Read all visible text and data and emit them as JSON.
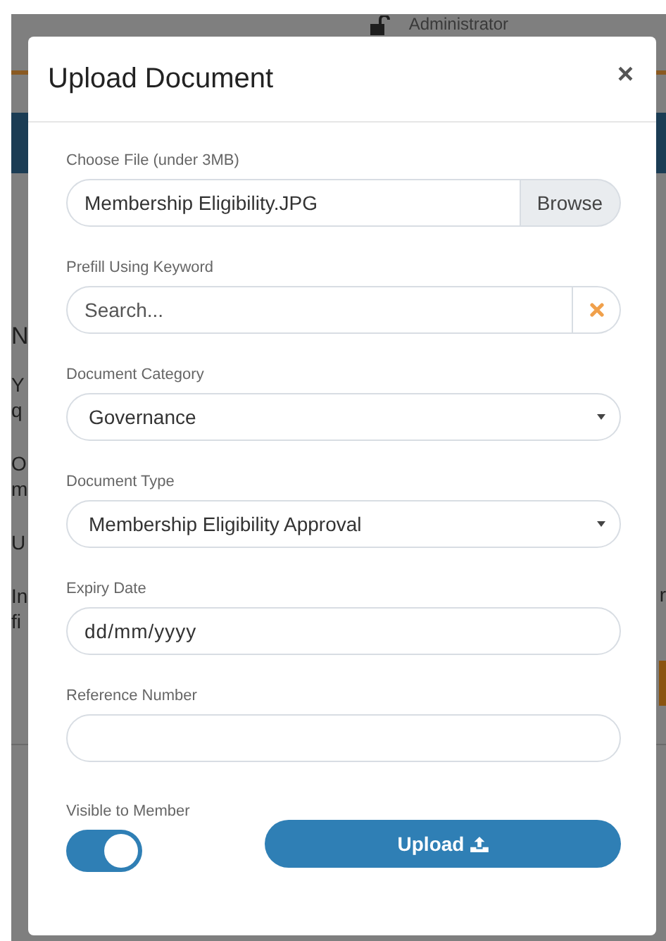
{
  "background": {
    "user": "Administrator",
    "paragraphs": [
      [
        "N"
      ],
      [
        "Y",
        "q"
      ],
      [
        "O",
        "m"
      ],
      [
        "U"
      ],
      [
        "In",
        "fi"
      ]
    ],
    "right_fragment": "r"
  },
  "dialog": {
    "title": "Upload Document",
    "close": "×"
  },
  "fields": [
    {
      "kind": "file",
      "label": "Choose File (under 3MB)",
      "value": "Membership Eligibility.JPG",
      "button": "Browse"
    },
    {
      "kind": "search",
      "label": "Prefill Using Keyword",
      "placeholder": "Search..."
    },
    {
      "kind": "select",
      "label": "Document Category",
      "value": "Governance"
    },
    {
      "kind": "select",
      "label": "Document Type",
      "value": "Membership Eligibility Approval"
    },
    {
      "kind": "date",
      "label": "Expiry Date",
      "value": "dd/mm/yyyy"
    },
    {
      "kind": "text",
      "label": "Reference Number"
    }
  ],
  "visibility": {
    "label": "Visible to Member",
    "on": true
  },
  "upload_button": "Upload"
}
